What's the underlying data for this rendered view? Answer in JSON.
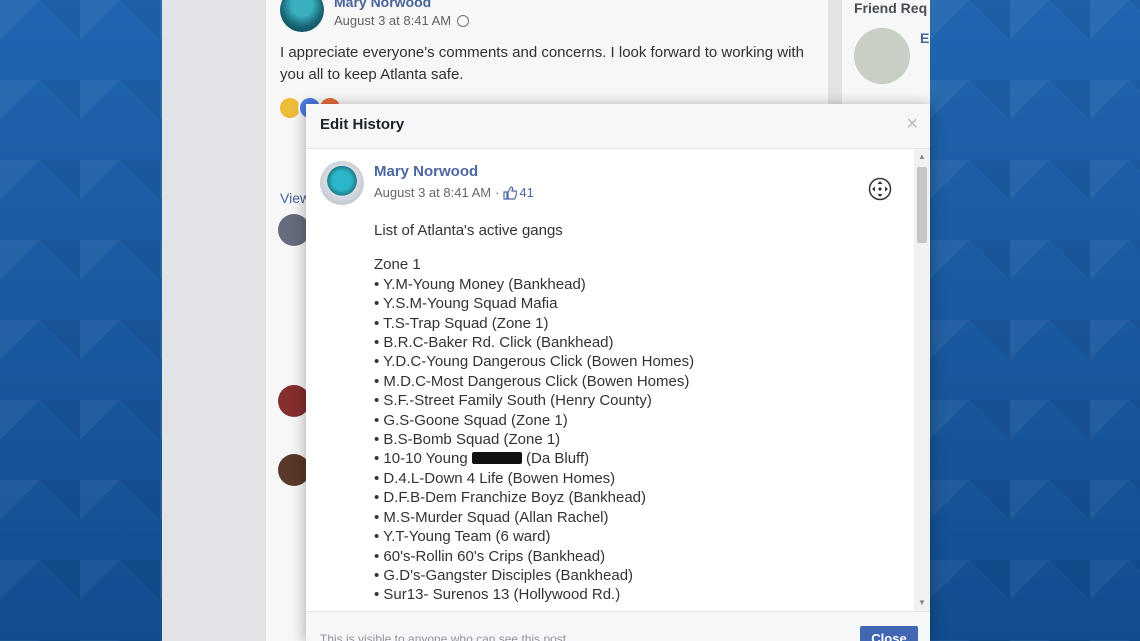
{
  "background_post": {
    "author": "Mary Norwood",
    "timestamp": "August 3 at 8:41 AM",
    "text": "I appreciate everyone's comments and concerns. I look forward to working with you all to keep Atlanta safe.",
    "view_more": "View"
  },
  "side_panel": {
    "friend_requests": "Friend Req",
    "friend_initial": "E"
  },
  "dialog": {
    "title": "Edit History",
    "close_icon": "×",
    "post": {
      "author": "Mary Norwood",
      "timestamp": "August 3 at 8:41 AM",
      "separator": "·",
      "likes": "41",
      "heading": "List of Atlanta's active gangs",
      "zone": "Zone 1",
      "lines": [
        "• Y.M-Young Money (Bankhead)",
        "• Y.S.M-Young Squad Mafia",
        "• T.S-Trap Squad (Zone 1)",
        "• B.R.C-Baker Rd. Click (Bankhead)",
        "• Y.D.C-Young Dangerous Click (Bowen Homes)",
        "• M.D.C-Most Dangerous Click (Bowen Homes)",
        "• S.F.-Street Family South (Henry County)",
        "• G.S-Goone Squad (Zone 1)",
        "• B.S-Bomb Squad (Zone 1)"
      ],
      "redacted_line": {
        "prefix": "• 10-10 Young ",
        "suffix": " (Da Bluff)"
      },
      "lines_after": [
        "• D.4.L-Down 4 Life (Bowen Homes)",
        "• D.F.B-Dem Franchize Boyz (Bankhead)",
        "• M.S-Murder Squad (Allan Rachel)",
        "• Y.T-Young Team (6 ward)",
        "• 60's-Rollin 60's Crips (Bankhead)",
        "• G.D's-Gangster Disciples (Bankhead)",
        "• Sur13- Surenos 13 (Hollywood Rd.)"
      ]
    },
    "footer_text": "This is visible to anyone who can see this post.",
    "close_button": "Close"
  },
  "colors": {
    "link_blue": "#4b67a1",
    "button_blue": "#4267b2",
    "frame_blue": "#1a5aa0"
  }
}
